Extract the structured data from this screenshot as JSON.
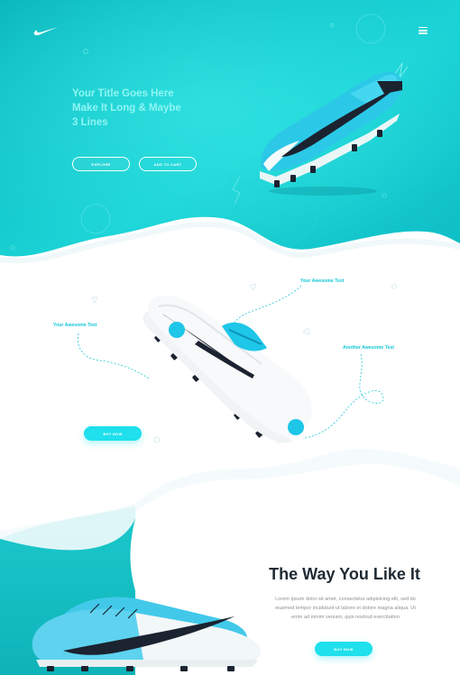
{
  "colors": {
    "accent": "#1fe0ec",
    "teal_dark": "#07b8bb",
    "teal_light": "#25dfe0",
    "annotation": "#14c8d6",
    "title_dark": "#1f2a33",
    "body_grey": "#8a9096"
  },
  "header": {
    "logo_icon": "nike-swoosh-icon",
    "menu_icon": "hamburger-menu-icon"
  },
  "hero": {
    "title_line1": "Your Title Goes Here",
    "title_line2": "Make It Long & Maybe",
    "title_line3": "3 Lines",
    "explore_label": "Explore",
    "add_to_cart_label": "Add to cart"
  },
  "features": {
    "annotation_1": "Your Awesome Text",
    "annotation_2": "Your Awesome Text",
    "annotation_3": "Another Awesome Text",
    "buy_label": "Buy now"
  },
  "bottom": {
    "title": "The Way You Like It",
    "body_line1": "Lorem ipsum dolor sit amet, consectetur adipisicing elit, sed do",
    "body_line2": "eiusmod tempor incididunt ut labore et dolore magna aliqua. Ut",
    "body_line3": "enim ad minim veniam, quis nostrud exercitation",
    "buy_label": "Buy now"
  }
}
